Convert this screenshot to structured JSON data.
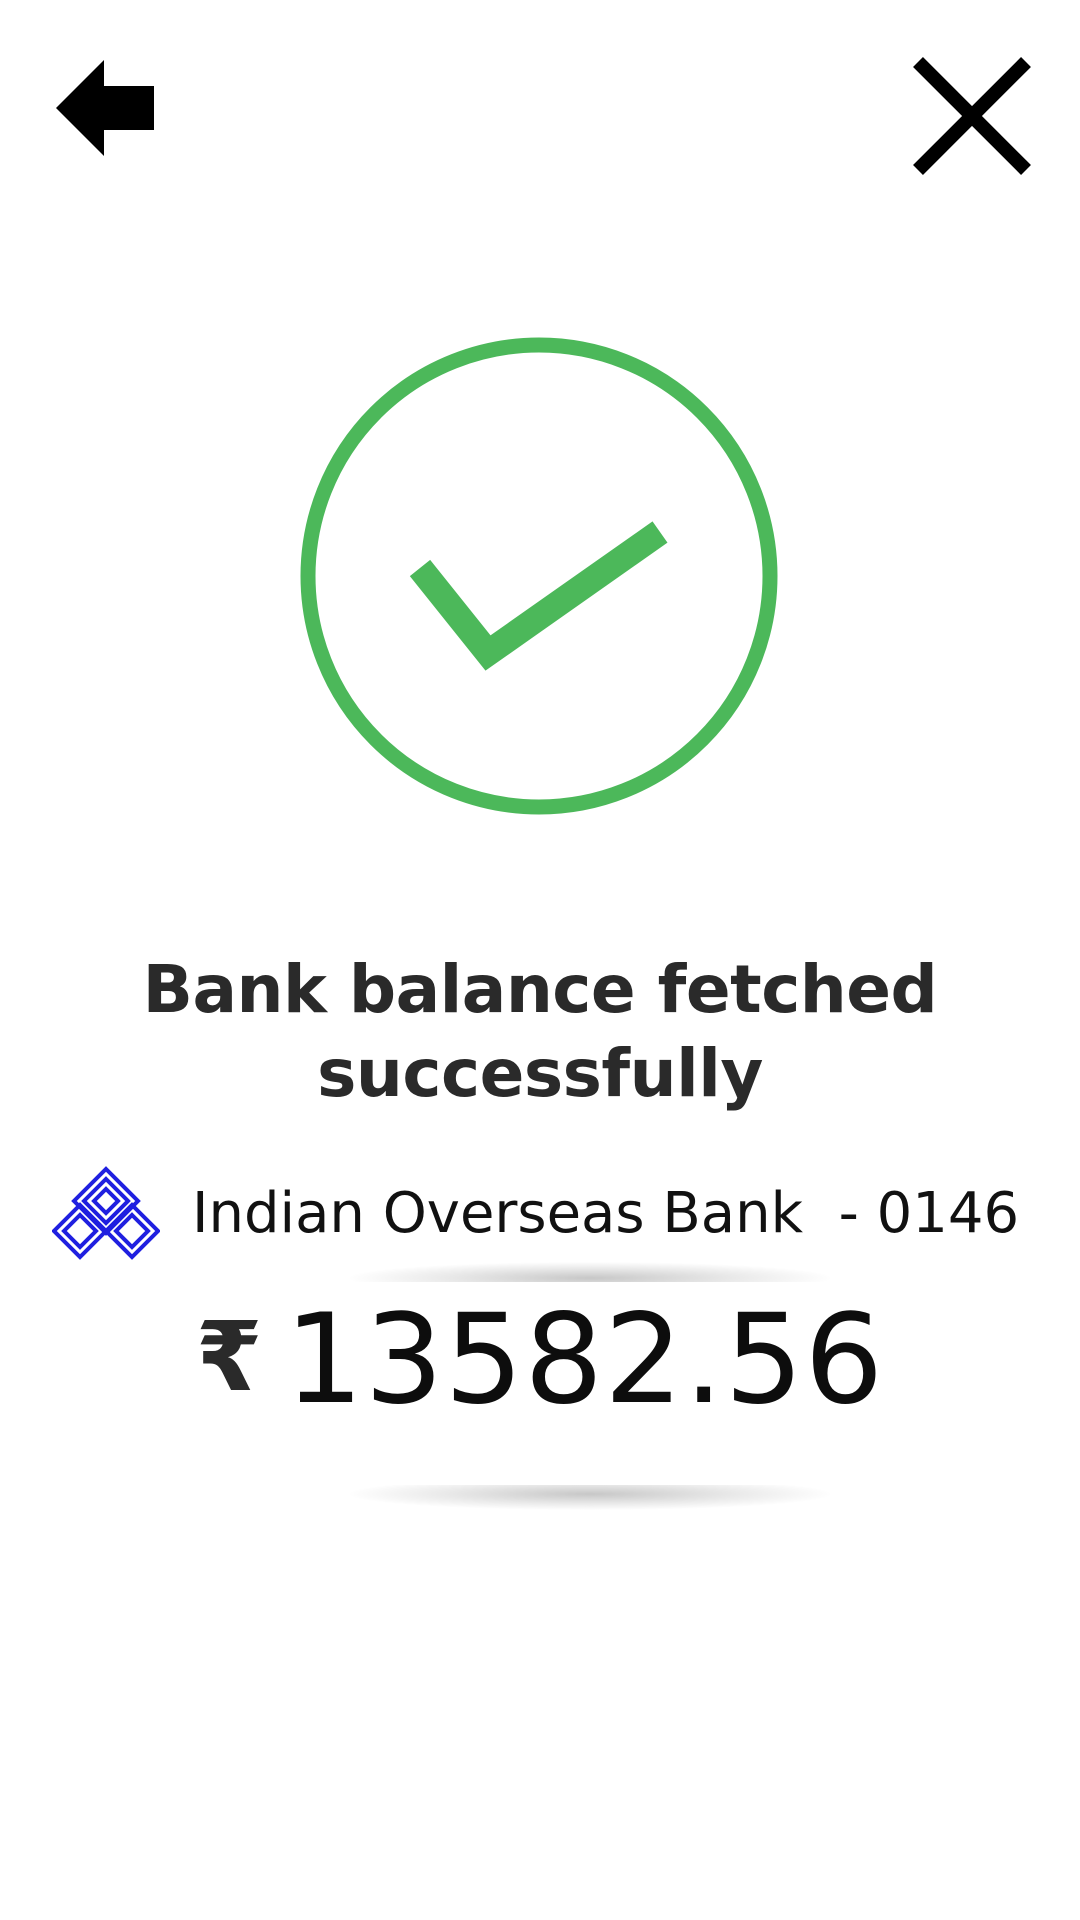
{
  "header": {
    "back_icon": "back-arrow-icon",
    "close_icon": "close-icon"
  },
  "status": {
    "icon": "check-circle-icon",
    "accent_color": "#4cb85a",
    "headline_line1": "Bank balance fetched",
    "headline_line2": "successfully"
  },
  "account": {
    "bank_logo": "indian-overseas-bank-logo",
    "bank_label": "Indian Overseas Bank  - 0146",
    "currency_symbol": "₹",
    "balance": "13582.56"
  }
}
